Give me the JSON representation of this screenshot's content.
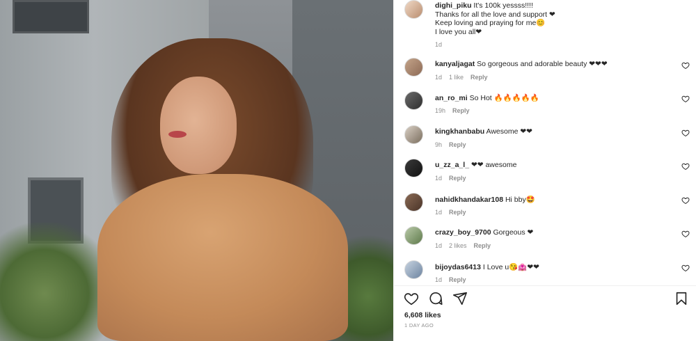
{
  "post": {
    "author": "dighi_piku",
    "caption_lines": [
      "It's 100k yessss!!!!",
      "Thanks for all the love and support ❤",
      "Keep loving and praying for me😊",
      "I love you all❤"
    ],
    "caption_time": "1d",
    "likes": "6,608 likes",
    "posted": "1 DAY AGO"
  },
  "comments": [
    {
      "user": "kanyaljagat",
      "text": "So gorgeous and adorable beauty ❤❤❤",
      "time": "1d",
      "likes": "1 like",
      "reply": "Reply"
    },
    {
      "user": "an_ro_mi",
      "text": "So Hot 🔥🔥🔥🔥🔥",
      "time": "19h",
      "likes": "",
      "reply": "Reply"
    },
    {
      "user": "kingkhanbabu",
      "text": "Awesome ❤❤",
      "time": "9h",
      "likes": "",
      "reply": "Reply"
    },
    {
      "user": "u_zz_a_l_",
      "text": "❤❤ awesome",
      "time": "1d",
      "likes": "",
      "reply": "Reply"
    },
    {
      "user": "nahidkhandakar108",
      "text": "Hi bby🤩",
      "time": "1d",
      "likes": "",
      "reply": "Reply"
    },
    {
      "user": "crazy_boy_9700",
      "text": "Gorgeous ❤",
      "time": "1d",
      "likes": "2 likes",
      "reply": "Reply"
    },
    {
      "user": "bijoydas6413",
      "text": "I Love u😘🏩❤❤",
      "time": "1d",
      "likes": "",
      "reply": "Reply"
    }
  ],
  "icons": {
    "like": "heart-icon",
    "comment": "comment-icon",
    "share": "share-icon",
    "save": "bookmark-icon",
    "comment_like": "heart-outline-icon"
  },
  "colors": {
    "text": "#262626",
    "muted": "#8e8e8e",
    "divider": "#efefef"
  }
}
